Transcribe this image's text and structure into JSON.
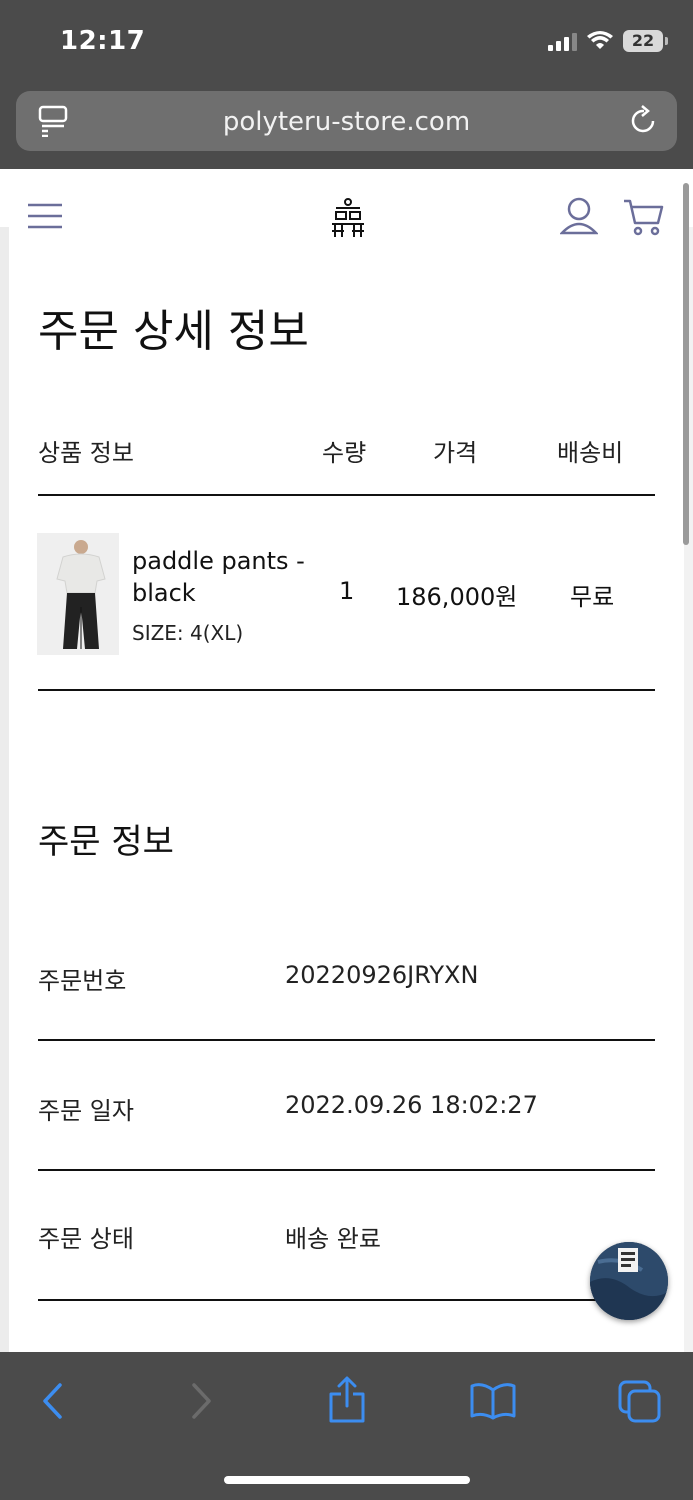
{
  "status_bar": {
    "time": "12:17",
    "battery": "22"
  },
  "browser": {
    "url": "polyteru-store.com"
  },
  "page": {
    "title": "주문 상세 정보",
    "product_table": {
      "headers": {
        "info": "상품 정보",
        "quantity": "수량",
        "price": "가격",
        "shipping": "배송비"
      },
      "item": {
        "name": "paddle pants - black",
        "size": "SIZE: 4(XL)",
        "quantity": "1",
        "price": "186,000원",
        "shipping": "무료"
      }
    },
    "order_info": {
      "title": "주문 정보",
      "rows": [
        {
          "label": "주문번호",
          "value": "20220926JRYXN"
        },
        {
          "label": "주문 일자",
          "value": "2022.09.26 18:02:27"
        },
        {
          "label": "주문 상태",
          "value": "배송 완료"
        }
      ]
    }
  },
  "colors": {
    "accent_icon": "#6b6e9a",
    "toolbar_blue": "#3c8df0",
    "chrome": "#4b4b4b"
  },
  "icons": [
    "reader-icon",
    "reload-icon",
    "menu-icon",
    "logo-icon",
    "user-icon",
    "cart-icon",
    "back-icon",
    "forward-icon",
    "share-icon",
    "bookmarks-icon",
    "tabs-icon"
  ]
}
